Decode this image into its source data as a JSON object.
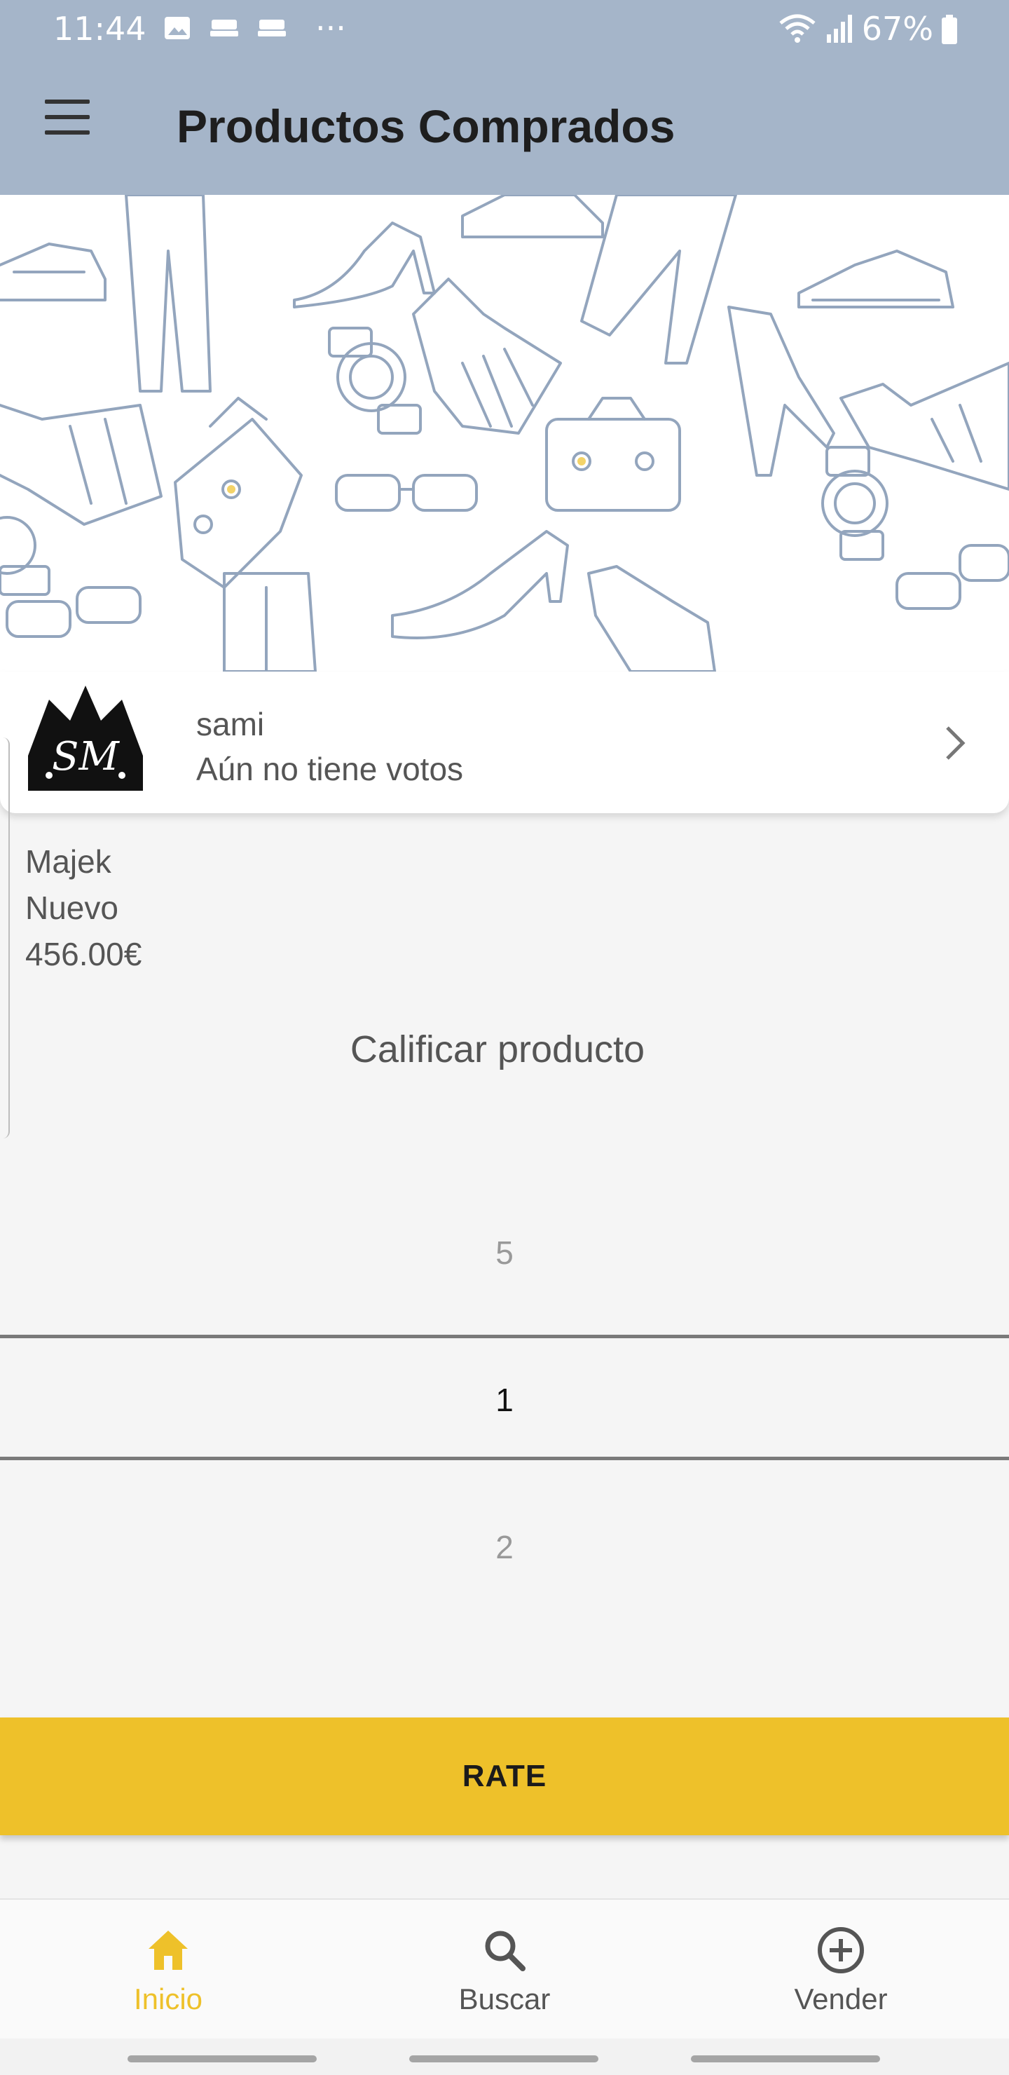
{
  "status_bar": {
    "time": "11:44",
    "battery": "67%",
    "icons": [
      "image-icon",
      "cast-icon",
      "cast-icon",
      "more-dots-icon",
      "wifi-icon",
      "signal-icon",
      "battery-icon"
    ],
    "more": "···"
  },
  "toolbar": {
    "title": "Productos Comprados",
    "menu_icon": "hamburger-menu-icon"
  },
  "seller": {
    "name": "sami",
    "votes": "Aún no tiene votos",
    "avatar_label": "SM"
  },
  "product": {
    "name": "Majek",
    "condition": "Nuevo",
    "price": "456.00€"
  },
  "rating": {
    "title": "Calificar producto",
    "picker": {
      "above": "5",
      "selected": "1",
      "below": "2"
    },
    "button": "RATE"
  },
  "bottom_nav": {
    "tabs": [
      {
        "label": "Inicio",
        "icon": "home-icon",
        "active": true
      },
      {
        "label": "Buscar",
        "icon": "search-icon",
        "active": false
      },
      {
        "label": "Vender",
        "icon": "add-circle-icon",
        "active": false
      }
    ]
  },
  "colors": {
    "toolbar": "#a5b5c9",
    "accent": "#eec12a",
    "illustration_stroke": "#93a5bd"
  }
}
